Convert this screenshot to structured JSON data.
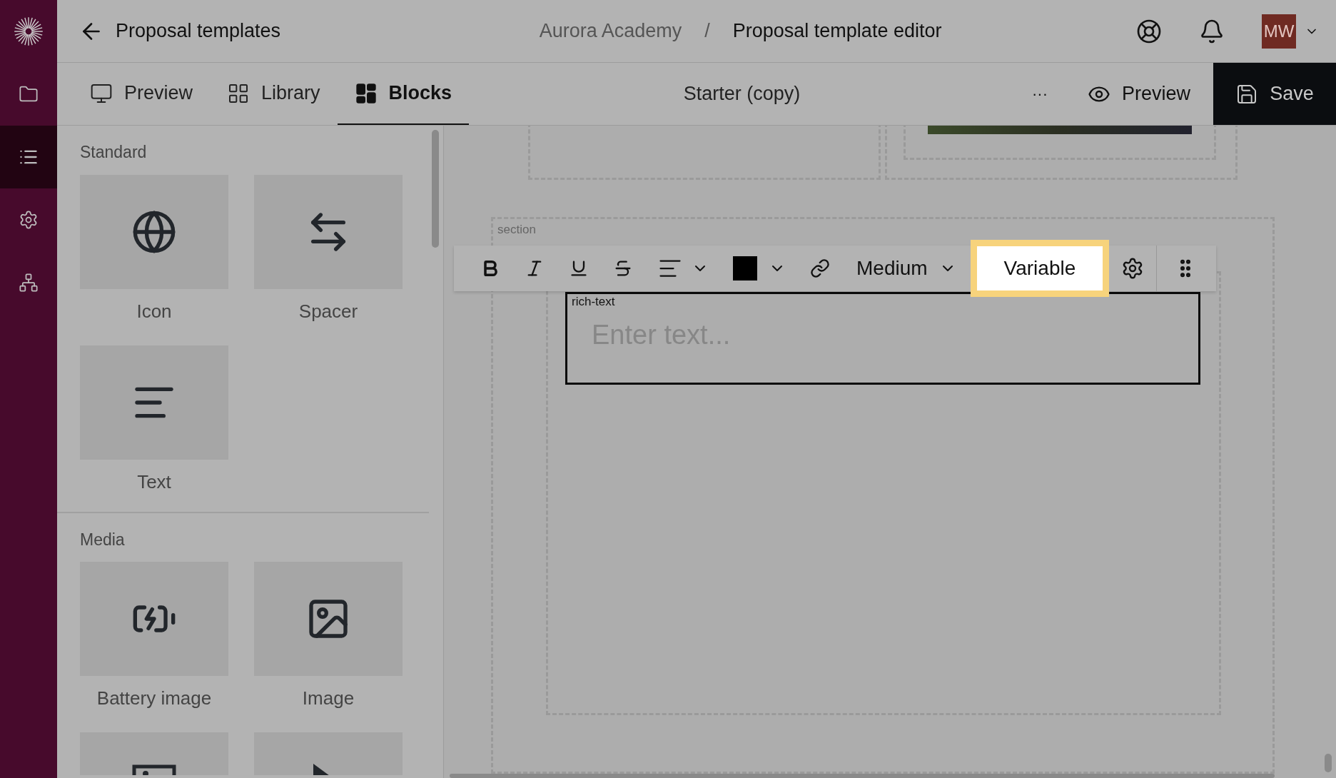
{
  "rail": [
    {
      "kind": "logo",
      "selected": false
    },
    {
      "kind": "folder",
      "selected": false
    },
    {
      "kind": "list",
      "selected": true
    },
    {
      "kind": "gear",
      "selected": false
    },
    {
      "kind": "sitemap",
      "selected": false
    }
  ],
  "header": {
    "back_label": "Proposal templates",
    "breadcrumb": [
      "Aurora Academy",
      "/",
      "Proposal template editor"
    ],
    "avatar": "MW"
  },
  "tabs": [
    {
      "kind": "preview",
      "label": "Preview",
      "selected": false
    },
    {
      "kind": "library",
      "label": "Library",
      "selected": false
    },
    {
      "kind": "blocks",
      "label": "Blocks",
      "selected": true
    }
  ],
  "document_title": "Starter (copy)",
  "actions": {
    "more": "···",
    "preview": "Preview",
    "save": "Save"
  },
  "block_sections": [
    {
      "title": "Standard",
      "blocks": [
        {
          "kind": "globe",
          "label": "Icon"
        },
        {
          "kind": "swap",
          "label": "Spacer"
        },
        {
          "kind": "text",
          "label": "Text"
        }
      ]
    },
    {
      "title": "Media",
      "blocks": [
        {
          "kind": "battery",
          "label": "Battery image"
        },
        {
          "kind": "image",
          "label": "Image"
        },
        {
          "kind": "picture"
        },
        {
          "kind": "play"
        }
      ]
    }
  ],
  "canvas": {
    "section_label": "section",
    "block_label": "rich-text",
    "placeholder": "Enter text..."
  },
  "toolbar": [
    {
      "kind": "bold"
    },
    {
      "kind": "italic"
    },
    {
      "kind": "underline"
    },
    {
      "kind": "strike"
    },
    {
      "kind": "align"
    },
    {
      "kind": "color",
      "color": "#000000"
    },
    {
      "kind": "link"
    },
    {
      "kind": "dropdown",
      "label": "Medium"
    },
    {
      "kind": "button",
      "label": "Variable",
      "highlighted": true
    },
    {
      "kind": "gear"
    },
    {
      "kind": "grip"
    }
  ]
}
